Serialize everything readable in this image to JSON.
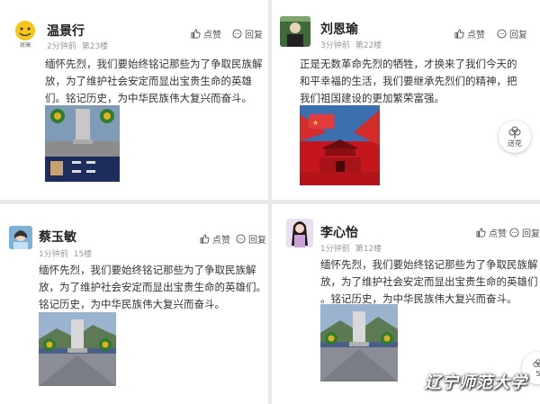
{
  "icons": {
    "like": "thumbs-up-icon",
    "reply": "comment-icon",
    "float": "flower-icon"
  },
  "comments": [
    {
      "name": "温景行",
      "time": "2分钟前",
      "floor": "第23楼",
      "like": "点赞",
      "reply": "回复",
      "avatar_text": "斑斓",
      "text_lines": [
        "缅怀先烈，我们要始终铭记那些为了争取民族解",
        "放，为了维护社会安定而显出宝贵生命的英雄",
        "们。铭记历史，为中华民族伟大复兴而奋斗。"
      ]
    },
    {
      "name": "刘恩瑜",
      "time": "3分钟前",
      "floor": "第22楼",
      "like": "点赞",
      "reply": "回复",
      "text_lines": [
        "正是无数革命先烈的牺牲，才换来了我们今天的",
        "和平幸福的生活，我们要继承先烈们的精神，把",
        "我们祖国建设的更加繁荣富强。"
      ]
    },
    {
      "name": "蔡玉敏",
      "time": "1分钟前",
      "floor": "15楼",
      "like": "点赞",
      "reply": "回复",
      "text_lines": [
        "缅怀先烈，我们要始终铭记那些为了争取民族解",
        "放，为了维护社会安定而显出宝贵生命的英雄们。",
        "铭记历史，为中华民族伟大复兴而奋斗。"
      ]
    },
    {
      "name": "李心怡",
      "time": "1分钟前",
      "floor": "第12楼",
      "like": "点赞",
      "reply": "回复",
      "text_lines": [
        "缅怀先烈，我们要始终铭记那些为了争取民族解",
        "放，为了维护社会安定而显出宝贵生命的英雄们",
        "。铭记历史，为中华民族伟大复兴而奋斗。"
      ]
    }
  ],
  "float_buttons": [
    {
      "label": "送花"
    },
    {
      "label": "5"
    }
  ],
  "watermark": "辽宁师范大学"
}
